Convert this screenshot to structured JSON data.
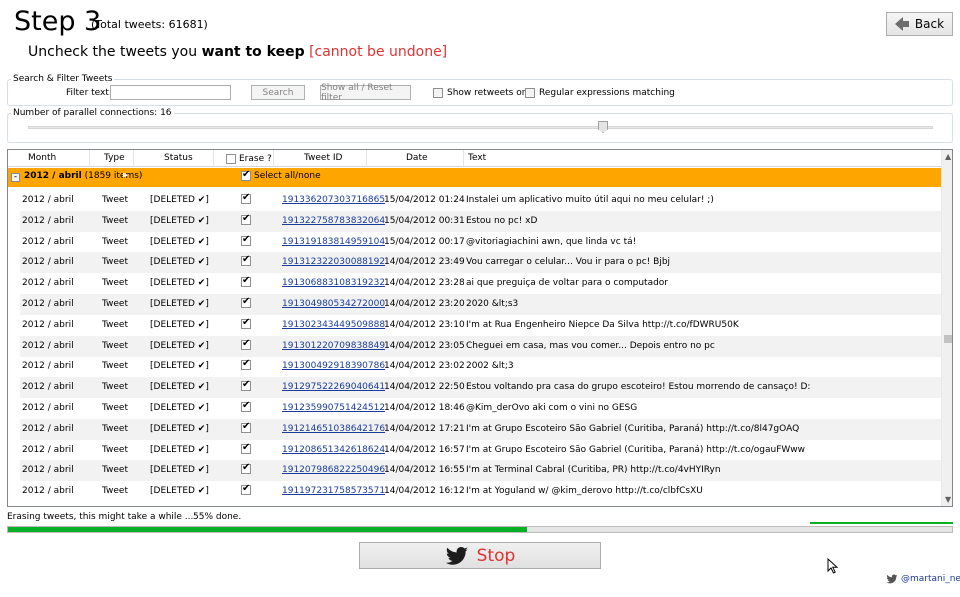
{
  "header": {
    "step_title": "Step 3",
    "total_tweets": "(Total tweets: 61681)",
    "back_label": "Back",
    "subtitle_prefix": "Uncheck the tweets you ",
    "subtitle_bold": "want to keep",
    "subtitle_warning": "[cannot be undone]"
  },
  "filter": {
    "group_title": "Search & Filter Tweets",
    "filter_label": "Filter text:",
    "filter_value": "",
    "search_label": "Search",
    "show_all_label": "Show all / Reset filter",
    "retweets_label": "Show retweets only",
    "retweets_checked": false,
    "regex_label": "Regular expressions matching",
    "regex_checked": false
  },
  "connections": {
    "label": "Number of parallel connections: 16",
    "value": 16
  },
  "grid": {
    "columns": {
      "month": "Month",
      "type": "Type",
      "status": "Status",
      "erase": "Erase ?",
      "tweet_id": "Tweet ID",
      "date": "Date",
      "text": "Text"
    },
    "group": {
      "expander": "-",
      "name": "2012 / abril",
      "count": "(1859 items)",
      "select_all": "Select all/none"
    },
    "rows": [
      {
        "month": "2012 / abril",
        "type": "Tweet",
        "status": "[DELETED ✔]",
        "erase": true,
        "id": "191336207303716865",
        "date": "15/04/2012 01:24",
        "text": "Instalei um aplicativo muito útil aqui no meu celular! ;)"
      },
      {
        "month": "2012 / abril",
        "type": "Tweet",
        "status": "[DELETED ✔]",
        "erase": true,
        "id": "191322758783832064",
        "date": "15/04/2012 00:31",
        "text": "Estou no pc! xD"
      },
      {
        "month": "2012 / abril",
        "type": "Tweet",
        "status": "[DELETED ✔]",
        "erase": true,
        "id": "191319183814959104",
        "date": "15/04/2012 00:17",
        "text": "@vitoriagiachini awn, que linda vc tá!"
      },
      {
        "month": "2012 / abril",
        "type": "Tweet",
        "status": "[DELETED ✔]",
        "erase": true,
        "id": "191312322030088192",
        "date": "14/04/2012 23:49",
        "text": "Vou carregar o celular... Vou ir para o pc! Bjbj"
      },
      {
        "month": "2012 / abril",
        "type": "Tweet",
        "status": "[DELETED ✔]",
        "erase": true,
        "id": "191306883108319232",
        "date": "14/04/2012 23:28",
        "text": "ai que preguiça de voltar para o computador"
      },
      {
        "month": "2012 / abril",
        "type": "Tweet",
        "status": "[DELETED ✔]",
        "erase": true,
        "id": "191304980534272000",
        "date": "14/04/2012 23:20",
        "text": "2020 &lt;s3"
      },
      {
        "month": "2012 / abril",
        "type": "Tweet",
        "status": "[DELETED ✔]",
        "erase": true,
        "id": "191302343449509888",
        "date": "14/04/2012 23:10",
        "text": "I'm at Rua Engenheiro Niepce Da Silva http://t.co/fDWRU50K"
      },
      {
        "month": "2012 / abril",
        "type": "Tweet",
        "status": "[DELETED ✔]",
        "erase": true,
        "id": "191301220709838849",
        "date": "14/04/2012 23:05",
        "text": "Cheguei em casa, mas vou comer... Depois entro no pc"
      },
      {
        "month": "2012 / abril",
        "type": "Tweet",
        "status": "[DELETED ✔]",
        "erase": true,
        "id": "191300492918390786",
        "date": "14/04/2012 23:02",
        "text": "2002 &lt;3"
      },
      {
        "month": "2012 / abril",
        "type": "Tweet",
        "status": "[DELETED ✔]",
        "erase": true,
        "id": "191297522269040641",
        "date": "14/04/2012 22:50",
        "text": "Estou voltando pra casa do grupo escoteiro! Estou morrendo de cansaço! D:"
      },
      {
        "month": "2012 / abril",
        "type": "Tweet",
        "status": "[DELETED ✔]",
        "erase": true,
        "id": "191235990751424512",
        "date": "14/04/2012 18:46",
        "text": "@Kim_derOvo aki com o vini no GESG"
      },
      {
        "month": "2012 / abril",
        "type": "Tweet",
        "status": "[DELETED ✔]",
        "erase": true,
        "id": "191214651038642176",
        "date": "14/04/2012 17:21",
        "text": "I'm at Grupo Escoteiro São Gabriel (Curitiba, Paraná) http://t.co/8l47gOAQ"
      },
      {
        "month": "2012 / abril",
        "type": "Tweet",
        "status": "[DELETED ✔]",
        "erase": true,
        "id": "191208651342618624",
        "date": "14/04/2012 16:57",
        "text": "I'm at Grupo Escoteiro São Gabriel (Curitiba, Paraná) http://t.co/ogauFWww"
      },
      {
        "month": "2012 / abril",
        "type": "Tweet",
        "status": "[DELETED ✔]",
        "erase": true,
        "id": "191207986822250496",
        "date": "14/04/2012 16:55",
        "text": "I'm at Terminal Cabral (Curitiba, PR) http://t.co/4vHYIRyn"
      },
      {
        "month": "2012 / abril",
        "type": "Tweet",
        "status": "[DELETED ✔]",
        "erase": true,
        "id": "191197231758573571",
        "date": "14/04/2012 16:12",
        "text": "I'm at Yoguland w/ @kim_derovo http://t.co/clbfCsXU"
      }
    ]
  },
  "progress": {
    "status_text": "Erasing tweets, this might take a while ...",
    "percent_text": "55% done.",
    "fraction": 0.55,
    "color": "#06b025"
  },
  "stop_button": {
    "label": "Stop",
    "color": "#e03232",
    "icon": "twitter-bird-icon"
  },
  "footer": {
    "handle": "@martani_net",
    "icon": "twitter-bird-icon"
  }
}
